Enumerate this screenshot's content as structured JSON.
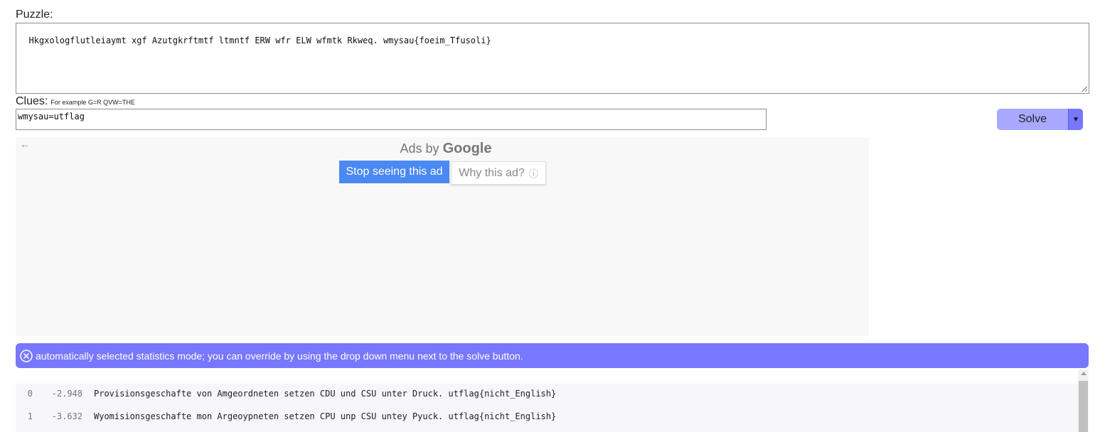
{
  "puzzle": {
    "label": "Puzzle:",
    "value": "Hkgxologflutleiaymt xgf Azutgkrftmtf ltmntf ERW wfr ELW wfmtk Rkweq. wmysau{foeim_Tfusoli}"
  },
  "clues": {
    "label": "Clues:",
    "hint": "For example G=R QVW=THE",
    "value": "wmysau=utflag"
  },
  "solve": {
    "label": "Solve",
    "dropdown": "▼"
  },
  "ad": {
    "back": "←",
    "ads_by": "Ads by",
    "google": "Google",
    "stop_label": "Stop seeing this ad",
    "why_label": "Why this ad?",
    "info_icon": "ⓘ"
  },
  "notice": {
    "text": "automatically selected statistics mode; you can override by using the drop down menu next to the solve button."
  },
  "results": [
    {
      "index": "0",
      "score": "-2.948",
      "text": "Provisionsgeschafte von Amgeordneten setzen CDU und CSU unter Druck. utflag{nicht_English}"
    },
    {
      "index": "1",
      "score": "-3.632",
      "text": "Wyomisionsgeschafte mon Argeoypneten setzen CPU unp CSU untey Pyuck. utflag{nicht_English}"
    }
  ]
}
